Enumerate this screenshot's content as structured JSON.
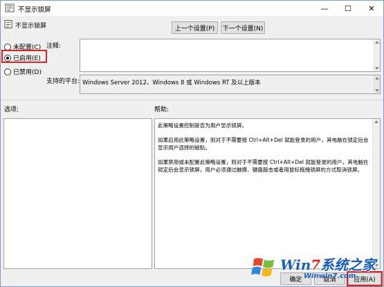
{
  "window": {
    "title": "不显示锁屏",
    "controls": {
      "minimize": "—",
      "maximize": "☐",
      "close": "✕"
    }
  },
  "header": {
    "policy_name": "不显示锁屏",
    "prev_button": "上一个设置(P)",
    "next_button": "下一个设置(N)"
  },
  "state_options": [
    {
      "label": "未配置(C)",
      "checked": false
    },
    {
      "label": "已启用(E)",
      "checked": true
    },
    {
      "label": "已禁用(D)",
      "checked": false
    }
  ],
  "comment": {
    "label": "注释:",
    "value": ""
  },
  "platform": {
    "label": "支持的平台:",
    "value": "Windows Server 2012、Windows 8 或 Windows RT 及以上版本"
  },
  "options": {
    "label": "选项:"
  },
  "help": {
    "label": "帮助:",
    "paragraphs": [
      "此策略设置控制是否为用户显示锁屏。",
      "如果启用此策略设置，则对于不需要按 Ctrl+Alt+Del 就能登录的用户，其电脑在锁定后会显示用户选择的磁贴。",
      "如果禁用或未配置此策略设置，则对于不需要按 Ctrl+Alt+Del 就能登录的用户，其电脑在锁定后会显示锁屏。用户必须通过触摸、键盘敲击或者用鼠标拖拽锁屏的方式取消锁屏。"
    ]
  },
  "buttons": {
    "ok": "确定",
    "cancel": "取消",
    "apply": "应用(A)"
  },
  "watermark": {
    "brand_prefix": "Win",
    "brand_seven": "7",
    "brand_suffix": "系统之家",
    "url": "Winwin7.com"
  },
  "colors": {
    "highlight": "#e02020",
    "window_bg": "#f0f0f0",
    "watermark_blue": "#1a5fb4"
  }
}
